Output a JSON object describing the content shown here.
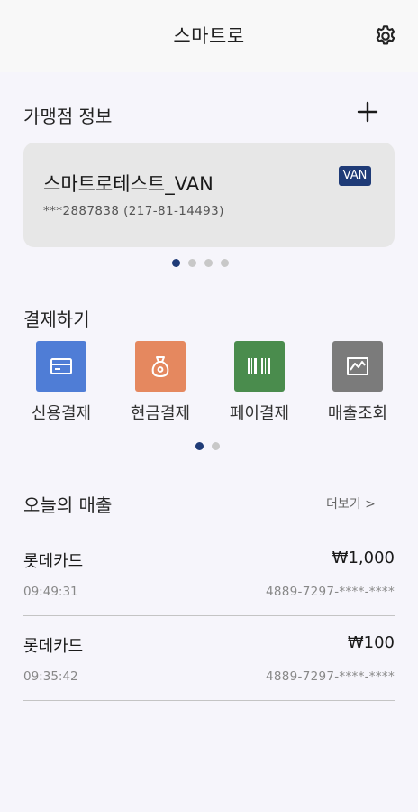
{
  "header": {
    "title": "스마트로"
  },
  "merchant": {
    "section_title": "가맹점 정보",
    "name": "스마트로테스트_VAN",
    "details": "***2887838 (217-81-14493)",
    "badge": "VAN",
    "page_count": 4,
    "active_page": 1
  },
  "payment": {
    "section_title": "결제하기",
    "items": [
      {
        "label": "신용결제",
        "icon": "credit-card-icon",
        "color": "#4f7dd6"
      },
      {
        "label": "현금결제",
        "icon": "money-bag-icon",
        "color": "#e5885f"
      },
      {
        "label": "페이결제",
        "icon": "barcode-icon",
        "color": "#4a8c4d"
      },
      {
        "label": "매출조회",
        "icon": "sales-chart-icon",
        "color": "#7b7b7b"
      }
    ],
    "page_count": 2,
    "active_page": 1
  },
  "sales": {
    "section_title": "오늘의 매출",
    "more_label": "더보기 >",
    "rows": [
      {
        "brand": "롯데카드",
        "amount": "₩1,000",
        "time": "09:49:31",
        "card": "4889-7297-****-****"
      },
      {
        "brand": "롯데카드",
        "amount": "₩100",
        "time": "09:35:42",
        "card": "4889-7297-****-****"
      }
    ]
  }
}
